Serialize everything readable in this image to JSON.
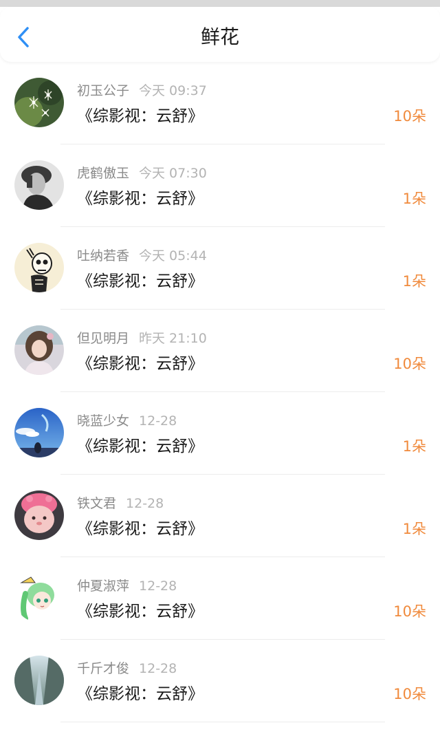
{
  "header": {
    "title": "鲜花",
    "back_icon": "chevron-left-icon",
    "accent_color": "#2f8ff5"
  },
  "colors": {
    "count": "#f08a3c",
    "name": "#8a8a8a",
    "time": "#b3b3b3"
  },
  "items": [
    {
      "name": "初玉公子",
      "time": "今天 09:37",
      "book": "《综影视：云舒》",
      "count": "10朵",
      "avatar": "avatar-sparkle-flowers"
    },
    {
      "name": "虎鹤傲玉",
      "time": "今天 07:30",
      "book": "《综影视：云舒》",
      "count": "1朵",
      "avatar": "avatar-bw-portrait"
    },
    {
      "name": "吐纳若香",
      "time": "今天 05:44",
      "book": "《综影视：云舒》",
      "count": "1朵",
      "avatar": "avatar-skull-sketch"
    },
    {
      "name": "但见明月",
      "time": "昨天 21:10",
      "book": "《综影视：云舒》",
      "count": "10朵",
      "avatar": "avatar-girl-photo"
    },
    {
      "name": "晓蓝少女",
      "time": "12-28",
      "book": "《综影视：云舒》",
      "count": "1朵",
      "avatar": "avatar-blue-sky"
    },
    {
      "name": "铁文君",
      "time": "12-28",
      "book": "《综影视：云舒》",
      "count": "1朵",
      "avatar": "avatar-pink-cat"
    },
    {
      "name": "仲夏淑萍",
      "time": "12-28",
      "book": "《综影视：云舒》",
      "count": "10朵",
      "avatar": "avatar-green-anime"
    },
    {
      "name": "千斤才俊",
      "time": "12-28",
      "book": "《综影视：云舒》",
      "count": "10朵",
      "avatar": "avatar-tree-tunnel"
    }
  ]
}
